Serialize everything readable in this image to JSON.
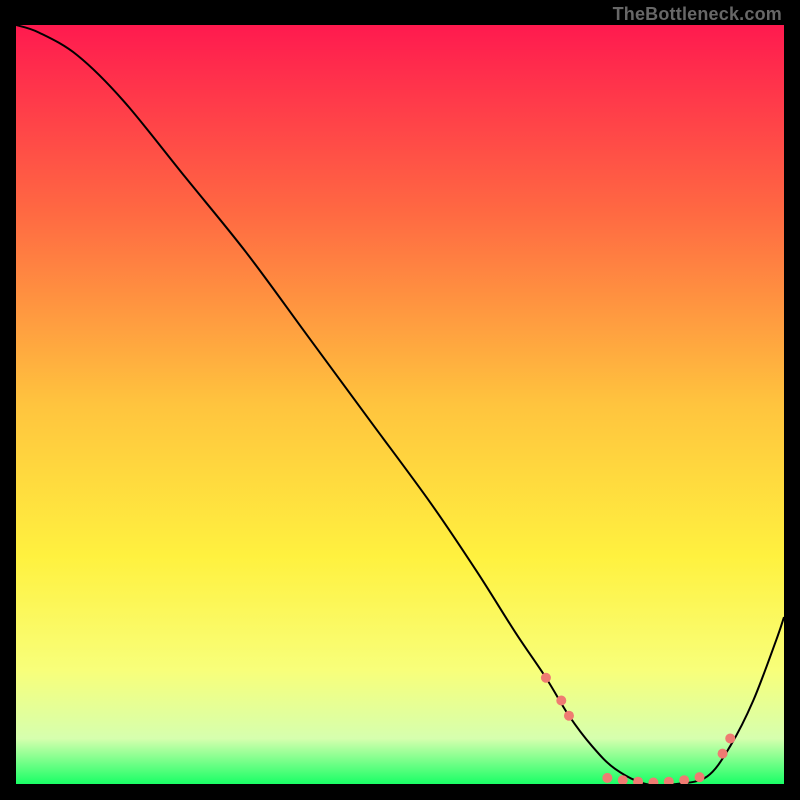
{
  "attribution": "TheBottleneck.com",
  "chart_data": {
    "type": "line",
    "title": "",
    "xlabel": "",
    "ylabel": "",
    "xlim": [
      0,
      100
    ],
    "ylim": [
      0,
      100
    ],
    "grid": false,
    "legend": false,
    "background_gradient": {
      "stops": [
        {
          "pct": 0,
          "color": "#ff1a4f"
        },
        {
          "pct": 25,
          "color": "#ff6a42"
        },
        {
          "pct": 50,
          "color": "#ffc43e"
        },
        {
          "pct": 70,
          "color": "#fff13f"
        },
        {
          "pct": 85,
          "color": "#f8ff7a"
        },
        {
          "pct": 94,
          "color": "#d6ffae"
        },
        {
          "pct": 100,
          "color": "#1aff66"
        }
      ]
    },
    "series": [
      {
        "name": "bottleneck-curve",
        "color": "#000000",
        "width": 2,
        "x": [
          0,
          3,
          8,
          14,
          22,
          30,
          38,
          46,
          54,
          60,
          65,
          69,
          72,
          75,
          78,
          82,
          86,
          90,
          93,
          96,
          99,
          100
        ],
        "values": [
          100,
          99,
          96,
          90,
          80,
          70,
          59,
          48,
          37,
          28,
          20,
          14,
          9,
          5,
          2,
          0,
          0,
          1,
          5,
          11,
          19,
          22
        ]
      }
    ],
    "markers": {
      "color": "#ef7b72",
      "radius": 5,
      "points": [
        {
          "x": 69,
          "y": 14
        },
        {
          "x": 71,
          "y": 11
        },
        {
          "x": 72,
          "y": 9
        },
        {
          "x": 77,
          "y": 0.8
        },
        {
          "x": 79,
          "y": 0.5
        },
        {
          "x": 81,
          "y": 0.3
        },
        {
          "x": 83,
          "y": 0.2
        },
        {
          "x": 85,
          "y": 0.3
        },
        {
          "x": 87,
          "y": 0.5
        },
        {
          "x": 89,
          "y": 0.9
        },
        {
          "x": 92,
          "y": 4
        },
        {
          "x": 93,
          "y": 6
        }
      ]
    }
  }
}
